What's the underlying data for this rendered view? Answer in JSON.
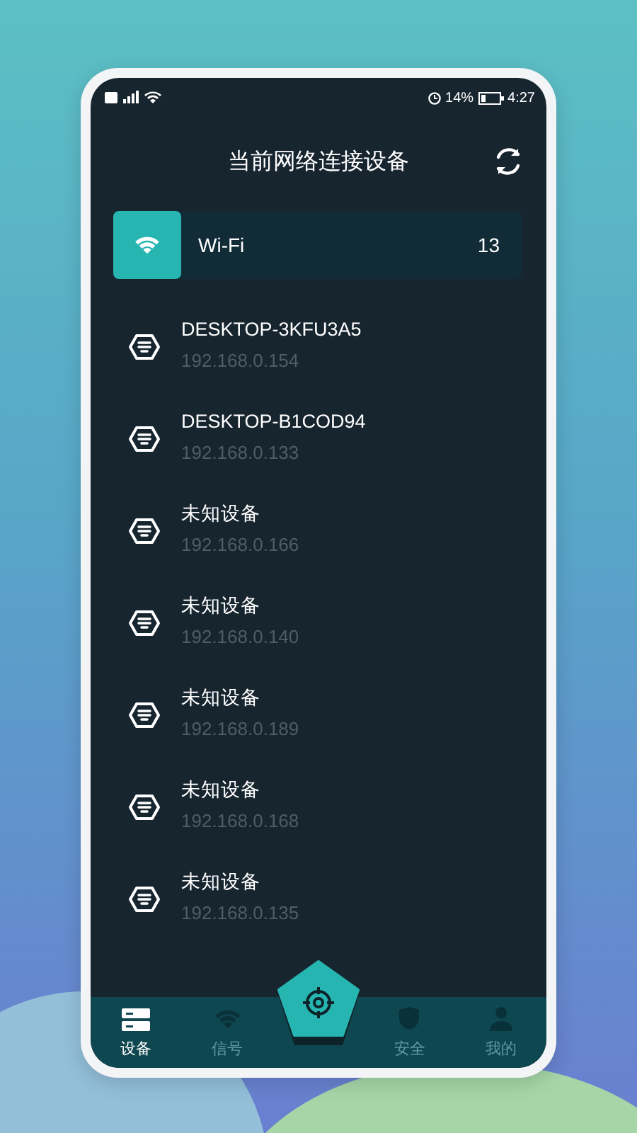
{
  "status_bar": {
    "battery": "14%",
    "time": "4:27"
  },
  "title": "当前网络连接设备",
  "network": {
    "name": "Wi-Fi",
    "count": "13"
  },
  "devices": [
    {
      "name": "DESKTOP-3KFU3A5",
      "ip": "192.168.0.154"
    },
    {
      "name": "DESKTOP-B1COD94",
      "ip": "192.168.0.133"
    },
    {
      "name": "未知设备",
      "ip": "192.168.0.166"
    },
    {
      "name": "未知设备",
      "ip": "192.168.0.140"
    },
    {
      "name": "未知设备",
      "ip": "192.168.0.189"
    },
    {
      "name": "未知设备",
      "ip": "192.168.0.168"
    },
    {
      "name": "未知设备",
      "ip": "192.168.0.135"
    }
  ],
  "tabs": [
    {
      "kind": "devices",
      "label": "设备",
      "selected": true
    },
    {
      "kind": "signal",
      "label": "信号",
      "selected": false
    },
    {
      "kind": "scan",
      "selected": false
    },
    {
      "kind": "security",
      "label": "安全",
      "selected": false
    },
    {
      "kind": "profile",
      "label": "我的",
      "selected": false
    }
  ]
}
